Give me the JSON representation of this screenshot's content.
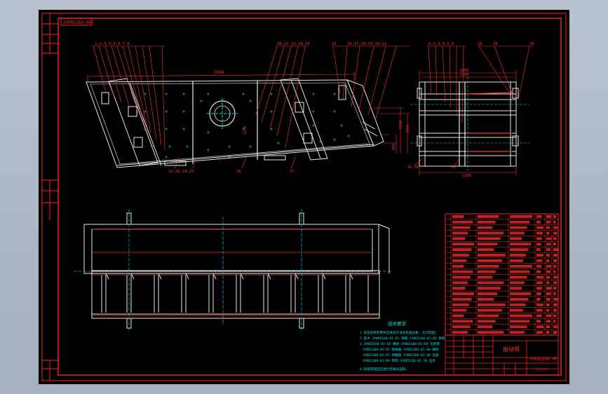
{
  "drawing": {
    "rotated_code": "3YKR2160-00",
    "overall_length": "7814",
    "side_width": "2260",
    "side_width_inner": "2100",
    "bottom_width": "2280",
    "title_block": {
      "name": "振动筛",
      "code": "3YKR2160-00",
      "subtitle": "?????"
    },
    "tech_req": {
      "heading": "技术要求",
      "lines": [
        "1.安装前所有零件应清洗干净并检查合格, 方可装配。",
        "2.其中 3YKR2160-01-01 筛箱 3YKR2160-01-02 侧板",
        "3.3YKR2160-01-03 横梁 3YKR2160-01-04 出料唇",
        "3YKR2160-01-05 激振器 3YKR2160-01-06 横梁",
        "3YKR2160-01-07 弹簧座 3YKR2160-01-08 支座",
        "3YKR2160-01-09 筛网 3YKR2160-01-10 压条",
        "4.装配完成后应进行空载试运转。"
      ]
    }
  },
  "colors": {
    "background": "#000000",
    "border": "#ff2020",
    "geometry": "#e8e8e8",
    "centerline": "#00e5e5",
    "dimension": "#ff3030"
  }
}
